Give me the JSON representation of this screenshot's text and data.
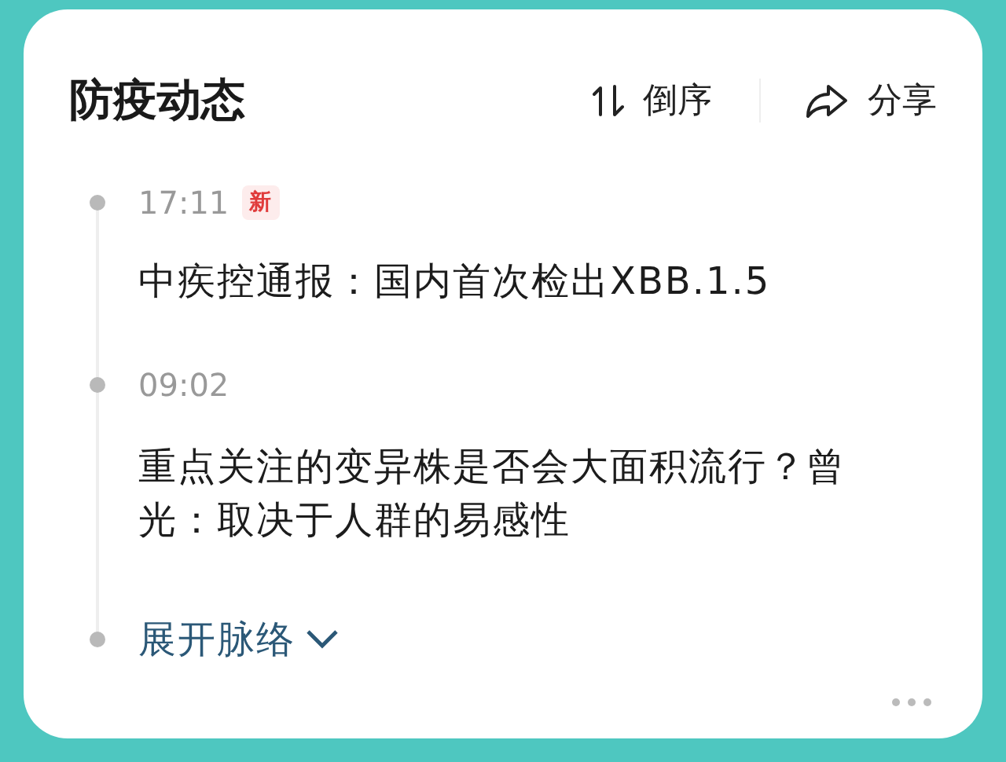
{
  "card": {
    "title": "防疫动态",
    "actions": [
      {
        "kind": "sort",
        "label": "倒序"
      },
      {
        "kind": "share",
        "label": "分享"
      }
    ],
    "timeline": [
      {
        "time": "17:11",
        "badge": "新",
        "headline": "中疾控通报：国内首次检出XBB.1.5"
      },
      {
        "time": "09:02",
        "headline": "重点关注的变异株是否会大面积流行？曾光：取决于人群的易感性"
      }
    ],
    "expand": {
      "label": "展开脉络",
      "expanded": false
    }
  }
}
